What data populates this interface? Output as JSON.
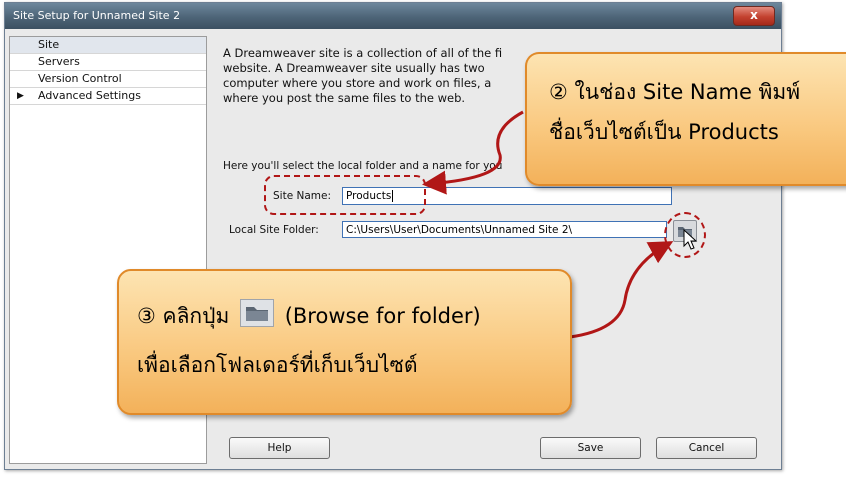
{
  "window": {
    "title": "Site Setup for Unnamed Site 2",
    "close_label": "x"
  },
  "sidebar": {
    "items": [
      {
        "label": "Site",
        "selected": true
      },
      {
        "label": "Servers"
      },
      {
        "label": "Version Control"
      },
      {
        "label": "Advanced Settings",
        "expandable": true
      }
    ]
  },
  "content": {
    "description_lines": [
      "A Dreamweaver site is a collection of all of the fi",
      "website. A Dreamweaver site usually has two",
      "computer where you store and work on files, a",
      "where you post the same files to the web."
    ],
    "hint": "Here you'll select the local folder and a name for you",
    "site_name_label": "Site Name:",
    "site_name_value": "Products",
    "local_folder_label": "Local Site Folder:",
    "local_folder_value": "C:\\Users\\User\\Documents\\Unnamed Site 2\\"
  },
  "buttons": {
    "help": "Help",
    "save": "Save",
    "cancel": "Cancel"
  },
  "callouts": {
    "step2": {
      "number": "②",
      "line1": "ในช่อง Site Name พิมพ์",
      "line2": "ชื่อเว็บไซต์เป็น Products"
    },
    "step3": {
      "number": "③",
      "line1_prefix": "คลิกปุ่ม",
      "line1_suffix": "(Browse for folder)",
      "line2": "เพื่อเลือกโฟลเดอร์ที่เก็บเว็บไซต์"
    }
  },
  "colors": {
    "callout_fill": "#f9c77d",
    "callout_border": "#e08a2a",
    "annotation_red": "#b11717"
  },
  "icons": {
    "browse": "folder-icon",
    "cursor": "mouse-pointer-icon"
  }
}
